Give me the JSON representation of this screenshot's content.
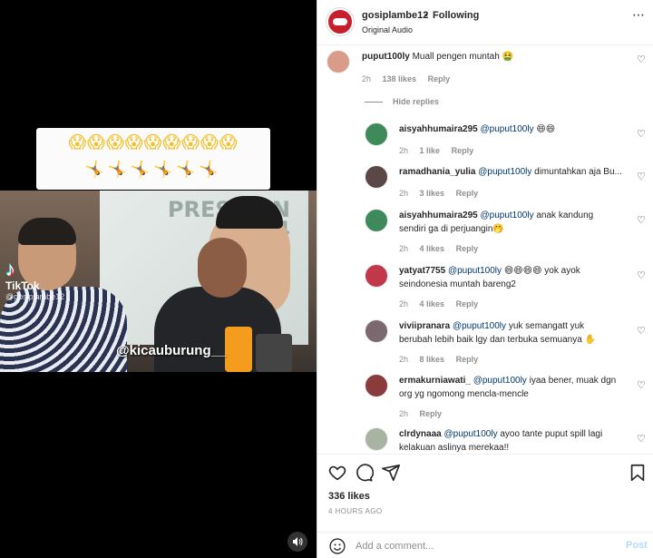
{
  "media": {
    "emoji_row_1": "😱😱😱😱😱😱😱😱😱",
    "emoji_row_2": "🤸🤸🤸🤸🤸🤸",
    "poster_text": "PRESIDEN\n2024",
    "tiktok_glyph": "♪",
    "tiktok_label": "TikTok",
    "tiktok_user": "@gosiplambe12",
    "watermark": "@kicauburung__",
    "sound_icon": "speaker-icon"
  },
  "header": {
    "username": "gosiplambe12",
    "separator": "•",
    "follow_status": "Following",
    "audio": "Original Audio",
    "more_icon": "more-options-icon"
  },
  "comments": [
    {
      "user": "puput100ly",
      "mention": "",
      "text": "Muall pengen muntah 🤮",
      "time": "2h",
      "likes": "138 likes",
      "reply": "Reply",
      "avatar_color": "#d99b8a"
    },
    {
      "user": "aisyahhumaira295",
      "mention": "@puput100ly",
      "text": "😄😄",
      "time": "2h",
      "likes": "1 like",
      "reply": "Reply",
      "avatar_color": "#3f8a5b"
    },
    {
      "user": "ramadhania_yulia",
      "mention": "@puput100ly",
      "text": "dimuntahkan aja Bu...",
      "time": "2h",
      "likes": "3 likes",
      "reply": "Reply",
      "avatar_color": "#5a4848"
    },
    {
      "user": "aisyahhumaira295",
      "mention": "@puput100ly",
      "text": "anak kandung sendiri ga di perjuangin🤭",
      "time": "2h",
      "likes": "4 likes",
      "reply": "Reply",
      "avatar_color": "#3f8a5b"
    },
    {
      "user": "yatyat7755",
      "mention": "@puput100ly",
      "text": "😄😄😄😄 yok ayok seindonesia muntah bareng2",
      "time": "2h",
      "likes": "4 likes",
      "reply": "Reply",
      "avatar_color": "#c0394a"
    },
    {
      "user": "viviipranara",
      "mention": "@puput100ly",
      "text": "yuk semangatt yuk berubah lebih baik lgy dan terbuka semuanya ✋",
      "time": "2h",
      "likes": "8 likes",
      "reply": "Reply",
      "avatar_color": "#7a6a70"
    },
    {
      "user": "ermakurniawati_",
      "mention": "@puput100ly",
      "text": "iyaa bener, muak dgn org yg ngomong mencla-mencle",
      "time": "2h",
      "likes": "",
      "reply": "Reply",
      "avatar_color": "#8a3b3b"
    },
    {
      "user": "clrdynaaa",
      "mention": "@puput100ly",
      "text": "ayoo tante puput spill lagi kelakuan aslinya merekaa!!",
      "time": "",
      "likes": "",
      "reply": "",
      "avatar_color": "#a8b3a2"
    }
  ],
  "hide_replies": "Hide replies",
  "actions": {
    "like_icon": "heart-icon",
    "comment_icon": "comment-icon",
    "share_icon": "share-icon",
    "save_icon": "bookmark-icon",
    "likes": "336 likes",
    "time": "4 HOURS AGO"
  },
  "composer": {
    "emoji_icon": "emoji-icon",
    "placeholder": "Add a comment...",
    "post_label": "Post"
  },
  "colors": {
    "accent": "#0095f6",
    "muted": "#8e8e8e",
    "mention": "#00376b",
    "brand_red": "#c71f2b"
  }
}
